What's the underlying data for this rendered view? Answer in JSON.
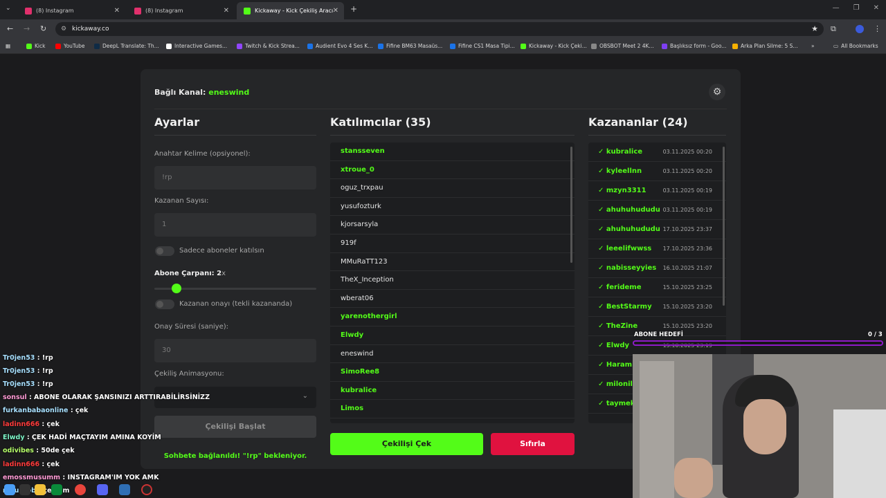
{
  "browser": {
    "tabs": [
      {
        "label": "(8) Instagram"
      },
      {
        "label": "(8) Instagram"
      },
      {
        "label": "Kickaway - Kick Çekiliş Aracı"
      }
    ],
    "url": "kickaway.co",
    "bookmarks": [
      "Kick",
      "YouTube",
      "DeepL Translate: Th...",
      "Interactive Games...",
      "Twitch & Kick Strea...",
      "Audient Evo 4 Ses K...",
      "Fifine BM63 Masaüs...",
      "Fifine CS1 Masa Tipi...",
      "Kickaway - Kick Çeki...",
      "OBSBOT Meet 2 4K...",
      "Başlıksız form - Goo...",
      "Arka Plan Silme: 5 S...",
      "All Bookmarks"
    ]
  },
  "app": {
    "channel_label": "Bağlı Kanal:",
    "channel_name": "eneswind",
    "settings": {
      "title": "Ayarlar",
      "keyword_label": "Anahtar Kelime (opsiyonel):",
      "keyword_placeholder": "!rp",
      "winner_count_label": "Kazanan Sayısı:",
      "winner_count_value": "1",
      "subs_only_label": "Sadece aboneler katılsın",
      "sub_multiplier_label": "Abone Çarpanı:",
      "sub_multiplier_value": "2",
      "sub_multiplier_unit": "x",
      "winner_confirm_label": "Kazanan onayı (tekli kazananda)",
      "confirm_time_label": "Onay Süresi (saniye):",
      "confirm_time_value": "30",
      "animation_label": "Çekiliş Animasyonu:",
      "start_button": "Çekilişi Başlat",
      "status": "Sohbete bağlanıldı! \"!rp\" bekleniyor."
    },
    "participants": {
      "title": "Katılımcılar (35)",
      "items": [
        {
          "name": "stansseven",
          "sub": true
        },
        {
          "name": "xtroue_0",
          "sub": true
        },
        {
          "name": "oguz_trxpau",
          "sub": false
        },
        {
          "name": "yusufozturk",
          "sub": false
        },
        {
          "name": "kjorsarsyla",
          "sub": false
        },
        {
          "name": "919f",
          "sub": false
        },
        {
          "name": "MMuRaTT123",
          "sub": false
        },
        {
          "name": "TheX_Inception",
          "sub": false
        },
        {
          "name": "wberat06",
          "sub": false
        },
        {
          "name": "yarenothergirl",
          "sub": true
        },
        {
          "name": "Elwdy",
          "sub": true
        },
        {
          "name": "eneswind",
          "sub": false
        },
        {
          "name": "SimoRee8",
          "sub": true
        },
        {
          "name": "kubralice",
          "sub": true
        },
        {
          "name": "Limos",
          "sub": true
        }
      ],
      "draw_button": "Çekilişi Çek",
      "reset_button": "Sıfırla"
    },
    "winners": {
      "title": "Kazananlar (24)",
      "items": [
        {
          "name": "✓ kubralice",
          "date": "03.11.2025 00:20"
        },
        {
          "name": "✓ kyleellnn",
          "date": "03.11.2025 00:20"
        },
        {
          "name": "✓ mzyn3311",
          "date": "03.11.2025 00:19"
        },
        {
          "name": "✓ ahuhuhududu",
          "date": "03.11.2025 00:19"
        },
        {
          "name": "✓ ahuhuhududu",
          "date": "17.10.2025 23:37"
        },
        {
          "name": "✓ leeelifwwss",
          "date": "17.10.2025 23:36"
        },
        {
          "name": "✓ nabisseyyies",
          "date": "16.10.2025 21:07"
        },
        {
          "name": "✓ ferideme",
          "date": "15.10.2025 23:25"
        },
        {
          "name": "✓ BestStarmy",
          "date": "15.10.2025 23:20"
        },
        {
          "name": "✓ TheZine",
          "date": "15.10.2025 23:20"
        },
        {
          "name": "✓ Elwdy",
          "date": "15.10.2025 23:19"
        },
        {
          "name": "✓ Haraml",
          "date": ""
        },
        {
          "name": "✓ milonil",
          "date": ""
        },
        {
          "name": "✓ taymek",
          "date": ""
        }
      ]
    }
  },
  "overlay": {
    "goal_label": "ABONE HEDEFİ",
    "goal_count": "0 / 3",
    "goal_progress": 0,
    "chat": [
      {
        "user": "Tr0jen53",
        "msg": ": !rp",
        "color": "#a8e0ff"
      },
      {
        "user": "Tr0jen53",
        "msg": ": !rp",
        "color": "#a8e0ff"
      },
      {
        "user": "Tr0jen53",
        "msg": ": !rp",
        "color": "#a8e0ff"
      },
      {
        "user": "sonsul",
        "msg": ": ABONE OLARAK ŞANSINIZI ARTTIRABİLİRSİNİZZ",
        "color": "#ff9ad5"
      },
      {
        "user": "furkanbabaonline",
        "msg": ": çek",
        "color": "#a8e0ff"
      },
      {
        "user": "ladinn666",
        "msg": ": çek",
        "color": "#ff3b3b"
      },
      {
        "user": "Elwdy",
        "msg": ": ÇEK HADİ MAÇTAYIM AMINA KOYİM",
        "color": "#7df5c8"
      },
      {
        "user": "odivibes",
        "msg": ": 50de çek",
        "color": "#b6ff6a"
      },
      {
        "user": "ladinn666",
        "msg": ": çek",
        "color": "#ff3b3b"
      },
      {
        "user": "emossmusumm",
        "msg": ": INSTAGRAM'IM YOK AMK",
        "color": "#ff9ad5"
      },
      {
        "user": "muuroob",
        "msg": ": çek am",
        "color": "#a8e0ff"
      }
    ]
  }
}
